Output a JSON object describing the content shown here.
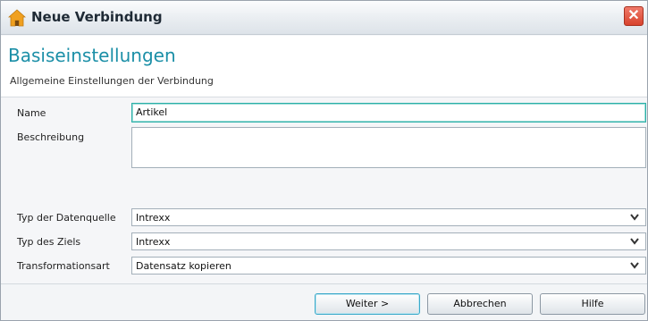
{
  "window": {
    "title": "Neue Verbindung",
    "close_glyph": "✕",
    "app_icon": "home-icon",
    "close_icon": "close-icon"
  },
  "header": {
    "title": "Basiseinstellungen",
    "subtitle": "Allgemeine Einstellungen der Verbindung"
  },
  "form": {
    "name_label": "Name",
    "name_value": "Artikel",
    "description_label": "Beschreibung",
    "description_value": "",
    "source_type_label": "Typ der Datenquelle",
    "source_type_value": "Intrexx",
    "target_type_label": "Typ des Ziels",
    "target_type_value": "Intrexx",
    "transform_label": "Transformationsart",
    "transform_value": "Datensatz kopieren",
    "dropdown_icon": "chevron-down-icon"
  },
  "buttons": {
    "next": "Weiter >",
    "cancel": "Abbrechen",
    "help": "Hilfe"
  },
  "colors": {
    "accent_title": "#1b8fa7",
    "focus_border": "#2bb0a8",
    "close_red": "#d8432d",
    "icon_orange": "#f0a020"
  }
}
